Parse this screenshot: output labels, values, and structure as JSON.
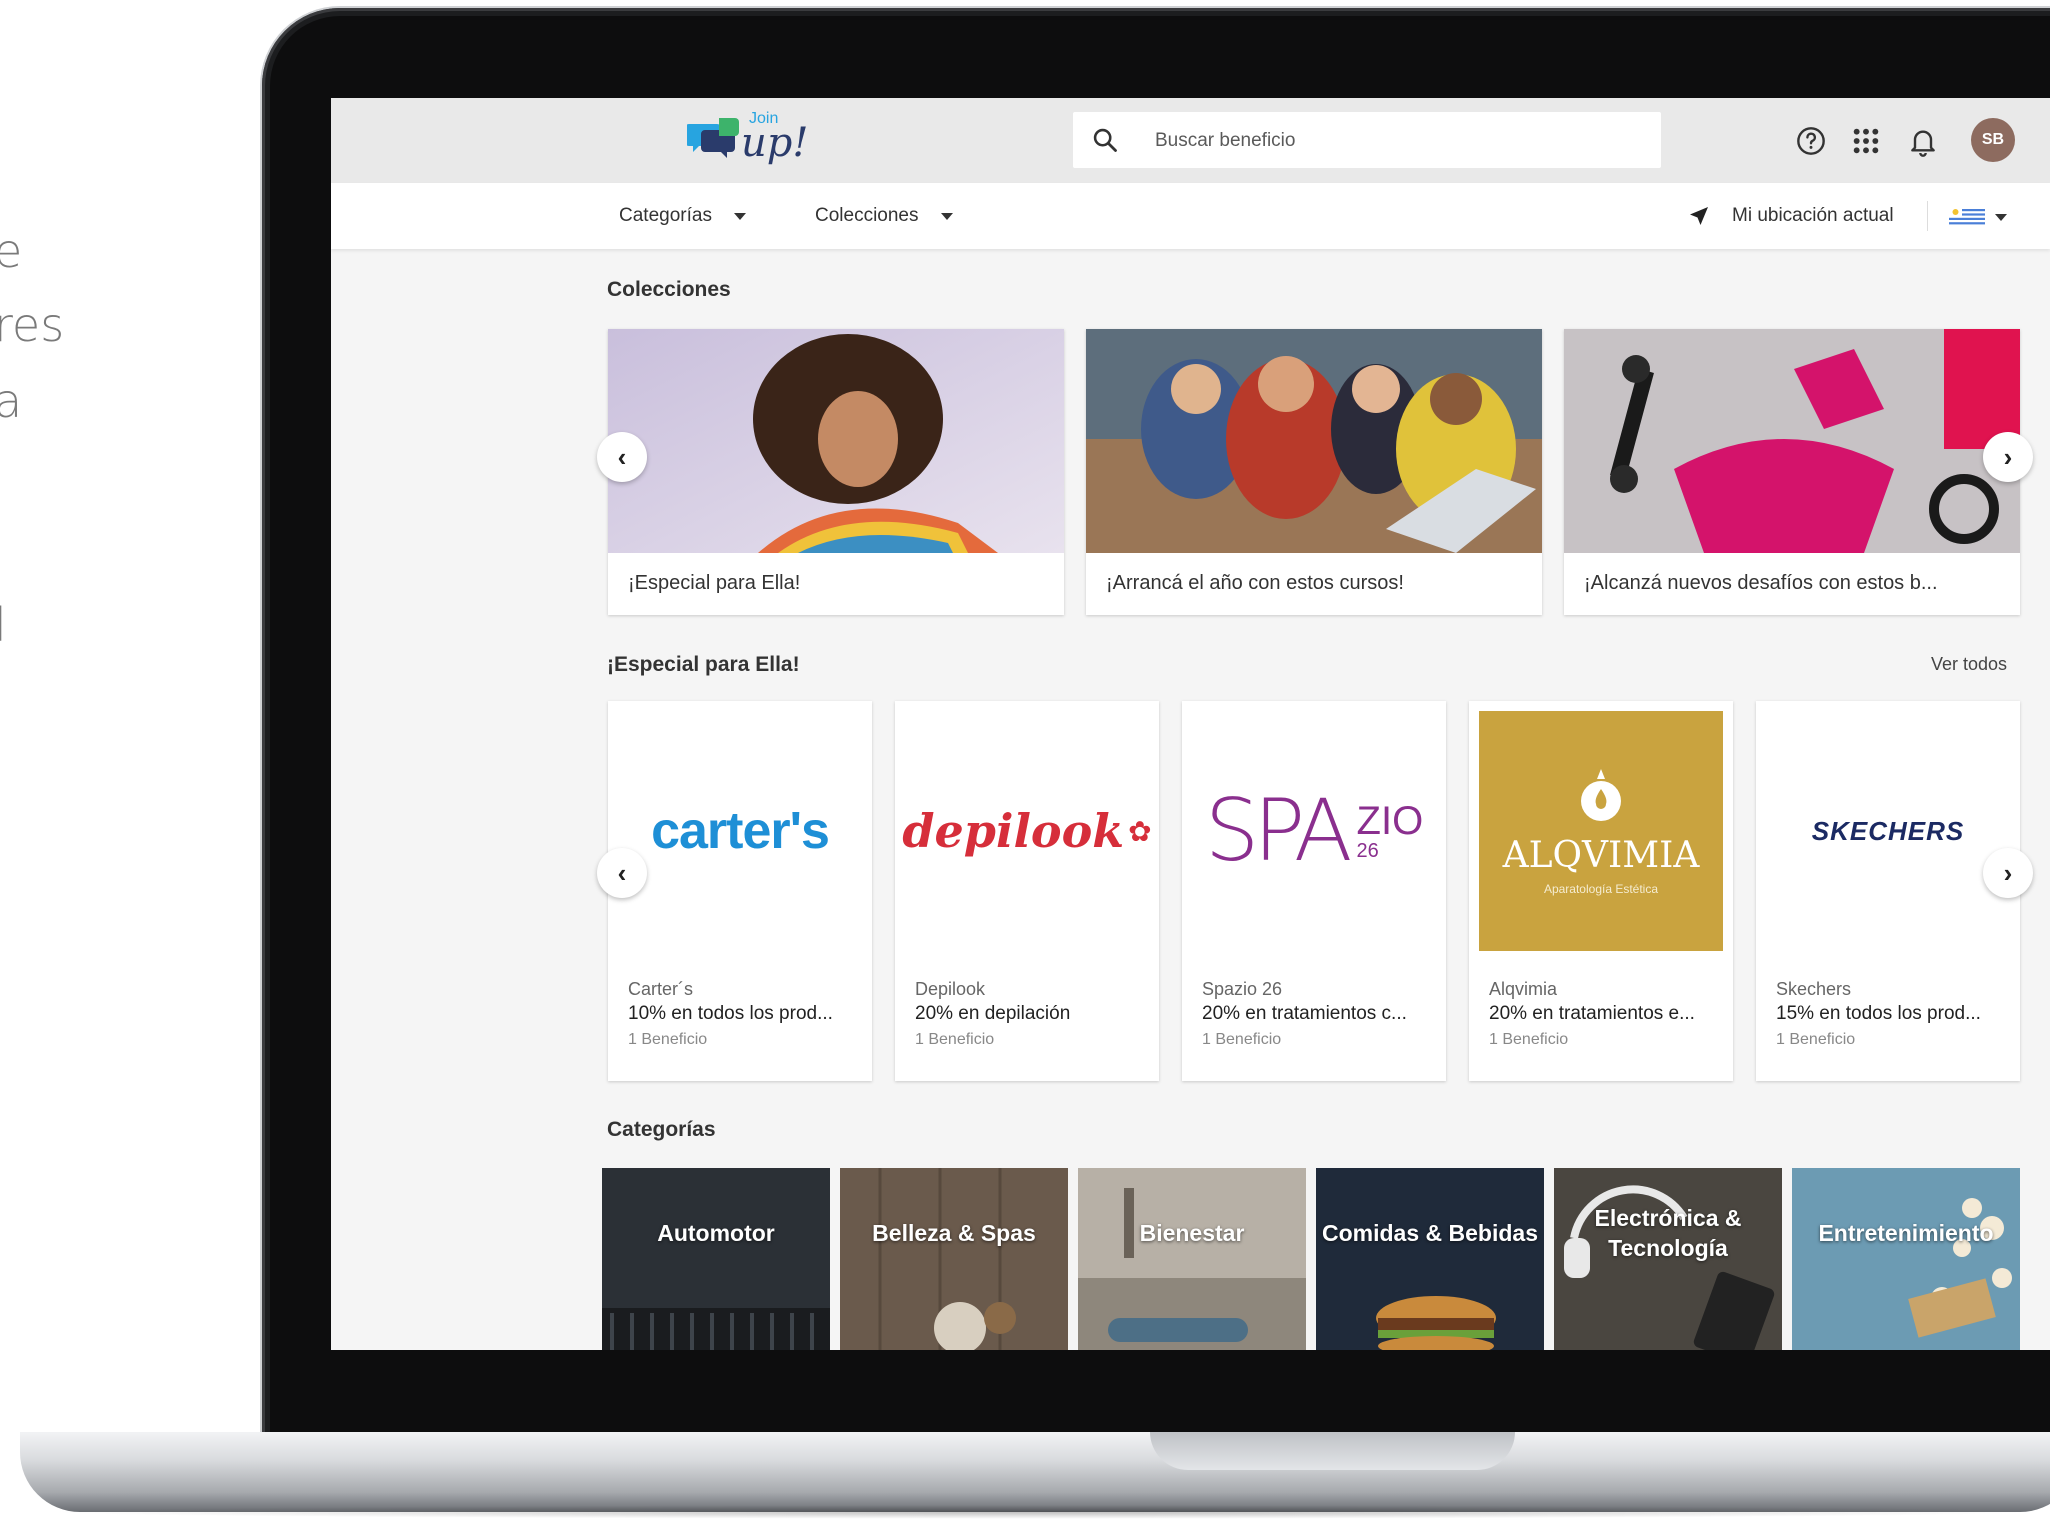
{
  "side_fragments": [
    "e",
    "res",
    "a",
    "l"
  ],
  "header": {
    "logo_small": "Join",
    "logo_big": "up!",
    "search_placeholder": "Buscar beneficio",
    "avatar_initials": "SB"
  },
  "nav": {
    "categories": "Categorías",
    "collections": "Colecciones",
    "location": "Mi ubicación actual"
  },
  "collections_section": {
    "title": "Colecciones",
    "cards": [
      {
        "label": "¡Especial para Ella!"
      },
      {
        "label": "¡Arrancá el año con estos cursos!"
      },
      {
        "label": "¡Alcanzá nuevos desafíos con estos b..."
      }
    ]
  },
  "featured_section": {
    "title": "¡Especial para Ella!",
    "see_all": "Ver todos",
    "brands": [
      {
        "logo_text": "carter's",
        "name": "Carter´s",
        "offer": "10% en todos los prod...",
        "count": "1 Beneficio"
      },
      {
        "logo_text": "depilook",
        "name": "Depilook",
        "offer": "20% en depilación",
        "count": "1 Beneficio"
      },
      {
        "logo_text": "SPA",
        "logo_text2": "ZIO",
        "logo_text3": "26",
        "name": "Spazio 26",
        "offer": "20% en tratamientos c...",
        "count": "1 Beneficio"
      },
      {
        "logo_text": "ALQVIMIA",
        "logo_sub": "Aparatología Estética",
        "name": "Alqvimia",
        "offer": "20% en tratamientos e...",
        "count": "1 Beneficio"
      },
      {
        "logo_text": "SKECHERS",
        "name": "Skechers",
        "offer": "15% en todos los prod...",
        "count": "1 Beneficio"
      }
    ]
  },
  "categories_section": {
    "title": "Categorías",
    "tiles": [
      {
        "label": "Automotor",
        "color": "#2b3036"
      },
      {
        "label": "Belleza & Spas",
        "color": "#6a5a4c"
      },
      {
        "label": "Bienestar",
        "color": "#a39c92"
      },
      {
        "label": "Comidas & Bebidas",
        "color": "#1f2a3a"
      },
      {
        "label": "Electrónica & Tecnología",
        "color": "#4a4640"
      },
      {
        "label": "Entretenimiento",
        "color": "#5e8fa8"
      }
    ]
  },
  "colors": {
    "brand_blue": "#27a4e0",
    "brand_navy": "#2a3b6b",
    "carters_blue": "#1e8fd6",
    "depilook_red": "#d62e3a",
    "spazio_purple": "#8a2f8e",
    "alqvimia_gold": "#c9a33f"
  }
}
